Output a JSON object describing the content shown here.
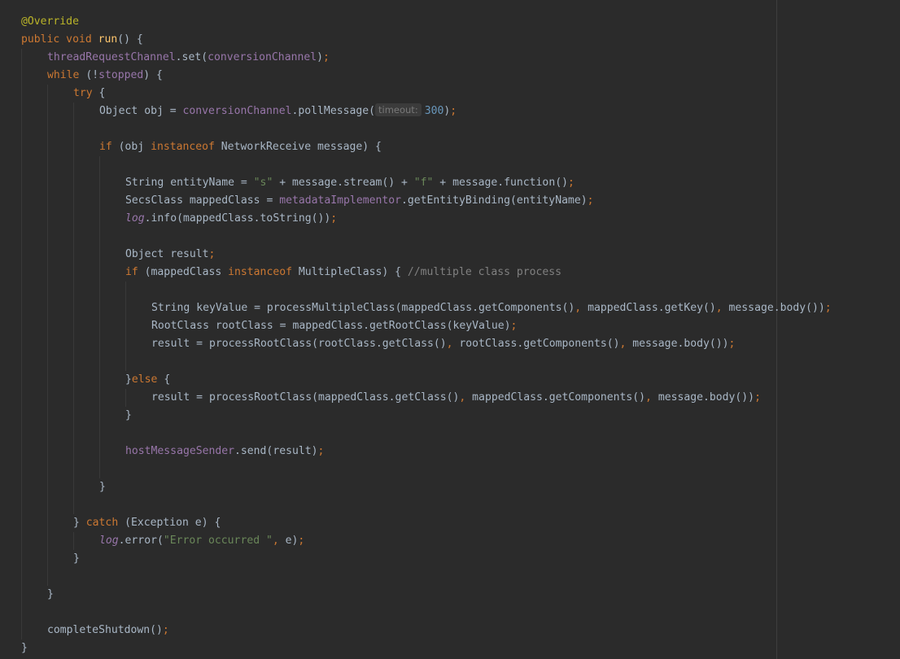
{
  "editor": {
    "lines": [
      {
        "indent": 0,
        "tokens": [
          {
            "t": "@Override",
            "k": "annotation"
          }
        ]
      },
      {
        "indent": 0,
        "tokens": [
          {
            "t": "public void ",
            "k": "keyword"
          },
          {
            "t": "run",
            "k": "method"
          },
          {
            "t": "() {",
            "k": "plain"
          }
        ]
      },
      {
        "indent": 1,
        "tokens": [
          {
            "t": "threadRequestChannel",
            "k": "field"
          },
          {
            "t": ".set(",
            "k": "plain"
          },
          {
            "t": "conversionChannel",
            "k": "field"
          },
          {
            "t": ")",
            "k": "plain"
          },
          {
            "t": ";",
            "k": "punct"
          }
        ]
      },
      {
        "indent": 1,
        "tokens": [
          {
            "t": "while ",
            "k": "keyword"
          },
          {
            "t": "(!",
            "k": "plain"
          },
          {
            "t": "stopped",
            "k": "field"
          },
          {
            "t": ") {",
            "k": "plain"
          }
        ]
      },
      {
        "indent": 2,
        "tokens": [
          {
            "t": "try ",
            "k": "keyword"
          },
          {
            "t": "{",
            "k": "plain"
          }
        ]
      },
      {
        "indent": 3,
        "tokens": [
          {
            "t": "Object ",
            "k": "plain"
          },
          {
            "t": "obj = ",
            "k": "plain"
          },
          {
            "t": "conversionChannel",
            "k": "field"
          },
          {
            "t": ".pollMessage(",
            "k": "plain"
          },
          {
            "t": "timeout:",
            "k": "hint"
          },
          {
            "t": "300",
            "k": "number"
          },
          {
            "t": ")",
            "k": "plain"
          },
          {
            "t": ";",
            "k": "punct"
          }
        ]
      },
      {
        "indent": 3,
        "tokens": []
      },
      {
        "indent": 3,
        "tokens": [
          {
            "t": "if ",
            "k": "keyword"
          },
          {
            "t": "(obj ",
            "k": "plain"
          },
          {
            "t": "instanceof ",
            "k": "keyword"
          },
          {
            "t": "NetworkReceive ",
            "k": "plain"
          },
          {
            "t": "message) {",
            "k": "plain"
          }
        ]
      },
      {
        "indent": 4,
        "tokens": []
      },
      {
        "indent": 4,
        "tokens": [
          {
            "t": "String ",
            "k": "plain"
          },
          {
            "t": "entityName = ",
            "k": "plain"
          },
          {
            "t": "\"s\"",
            "k": "string"
          },
          {
            "t": " + message.stream() + ",
            "k": "plain"
          },
          {
            "t": "\"f\"",
            "k": "string"
          },
          {
            "t": " + message.function()",
            "k": "plain"
          },
          {
            "t": ";",
            "k": "punct"
          }
        ]
      },
      {
        "indent": 4,
        "tokens": [
          {
            "t": "SecsClass ",
            "k": "plain"
          },
          {
            "t": "mappedClass = ",
            "k": "plain"
          },
          {
            "t": "metadataImplementor",
            "k": "field"
          },
          {
            "t": ".getEntityBinding(entityName)",
            "k": "plain"
          },
          {
            "t": ";",
            "k": "punct"
          }
        ]
      },
      {
        "indent": 4,
        "tokens": [
          {
            "t": "log",
            "k": "italic-field"
          },
          {
            "t": ".info(mappedClass.toString())",
            "k": "plain"
          },
          {
            "t": ";",
            "k": "punct"
          }
        ]
      },
      {
        "indent": 4,
        "tokens": []
      },
      {
        "indent": 4,
        "tokens": [
          {
            "t": "Object ",
            "k": "plain"
          },
          {
            "t": "result",
            "k": "plain"
          },
          {
            "t": ";",
            "k": "punct"
          }
        ]
      },
      {
        "indent": 4,
        "tokens": [
          {
            "t": "if ",
            "k": "keyword"
          },
          {
            "t": "(mappedClass ",
            "k": "plain"
          },
          {
            "t": "instanceof ",
            "k": "keyword"
          },
          {
            "t": "MultipleClass) { ",
            "k": "plain"
          },
          {
            "t": "//multiple class process",
            "k": "comment"
          }
        ]
      },
      {
        "indent": 5,
        "tokens": []
      },
      {
        "indent": 5,
        "tokens": [
          {
            "t": "String ",
            "k": "plain"
          },
          {
            "t": "keyValue = processMultipleClass(mappedClass.getComponents()",
            "k": "plain"
          },
          {
            "t": ", ",
            "k": "punct"
          },
          {
            "t": "mappedClass.getKey()",
            "k": "plain"
          },
          {
            "t": ", ",
            "k": "punct"
          },
          {
            "t": "message.body())",
            "k": "plain"
          },
          {
            "t": ";",
            "k": "punct"
          }
        ]
      },
      {
        "indent": 5,
        "tokens": [
          {
            "t": "RootClass ",
            "k": "plain"
          },
          {
            "t": "rootClass = mappedClass.getRootClass(keyValue)",
            "k": "plain"
          },
          {
            "t": ";",
            "k": "punct"
          }
        ]
      },
      {
        "indent": 5,
        "tokens": [
          {
            "t": "result = processRootClass(rootClass.getClass()",
            "k": "plain"
          },
          {
            "t": ", ",
            "k": "punct"
          },
          {
            "t": "rootClass.getComponents()",
            "k": "plain"
          },
          {
            "t": ", ",
            "k": "punct"
          },
          {
            "t": "message.body())",
            "k": "plain"
          },
          {
            "t": ";",
            "k": "punct"
          }
        ]
      },
      {
        "indent": 5,
        "tokens": []
      },
      {
        "indent": 4,
        "tokens": [
          {
            "t": "}",
            "k": "plain"
          },
          {
            "t": "else ",
            "k": "keyword"
          },
          {
            "t": "{",
            "k": "plain"
          }
        ]
      },
      {
        "indent": 5,
        "tokens": [
          {
            "t": "result = processRootClass(mappedClass.getClass()",
            "k": "plain"
          },
          {
            "t": ", ",
            "k": "punct"
          },
          {
            "t": "mappedClass.getComponents()",
            "k": "plain"
          },
          {
            "t": ", ",
            "k": "punct"
          },
          {
            "t": "message.body())",
            "k": "plain"
          },
          {
            "t": ";",
            "k": "punct"
          }
        ]
      },
      {
        "indent": 4,
        "tokens": [
          {
            "t": "}",
            "k": "plain"
          }
        ]
      },
      {
        "indent": 4,
        "tokens": []
      },
      {
        "indent": 4,
        "tokens": [
          {
            "t": "hostMessageSender",
            "k": "field"
          },
          {
            "t": ".send(result)",
            "k": "plain"
          },
          {
            "t": ";",
            "k": "punct"
          }
        ]
      },
      {
        "indent": 4,
        "tokens": []
      },
      {
        "indent": 3,
        "tokens": [
          {
            "t": "}",
            "k": "plain"
          }
        ]
      },
      {
        "indent": 3,
        "tokens": []
      },
      {
        "indent": 2,
        "tokens": [
          {
            "t": "} ",
            "k": "plain"
          },
          {
            "t": "catch ",
            "k": "keyword"
          },
          {
            "t": "(Exception e) {",
            "k": "plain"
          }
        ]
      },
      {
        "indent": 3,
        "tokens": [
          {
            "t": "log",
            "k": "italic-field"
          },
          {
            "t": ".error(",
            "k": "plain"
          },
          {
            "t": "\"Error occurred \"",
            "k": "string"
          },
          {
            "t": ", ",
            "k": "punct"
          },
          {
            "t": "e)",
            "k": "plain"
          },
          {
            "t": ";",
            "k": "punct"
          }
        ]
      },
      {
        "indent": 2,
        "tokens": [
          {
            "t": "}",
            "k": "plain"
          }
        ]
      },
      {
        "indent": 2,
        "tokens": []
      },
      {
        "indent": 1,
        "tokens": [
          {
            "t": "}",
            "k": "plain"
          }
        ]
      },
      {
        "indent": 1,
        "tokens": []
      },
      {
        "indent": 1,
        "tokens": [
          {
            "t": "completeShutdown()",
            "k": "plain"
          },
          {
            "t": ";",
            "k": "punct"
          }
        ]
      },
      {
        "indent": 0,
        "tokens": [
          {
            "t": "}",
            "k": "plain"
          }
        ]
      }
    ]
  }
}
